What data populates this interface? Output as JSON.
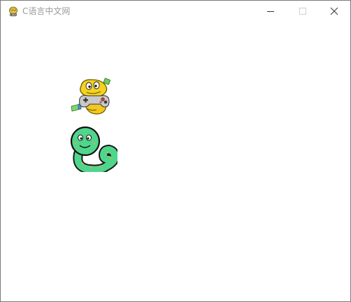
{
  "window": {
    "title": "C语言中文网",
    "icon": "pygame-snake-icon",
    "controls": [
      "minimize",
      "maximize",
      "close"
    ]
  },
  "canvas": {
    "background": "#ffffff",
    "sprites": [
      {
        "name": "python-gamepad-mascot"
      },
      {
        "name": "green-snake-mascot"
      }
    ]
  }
}
